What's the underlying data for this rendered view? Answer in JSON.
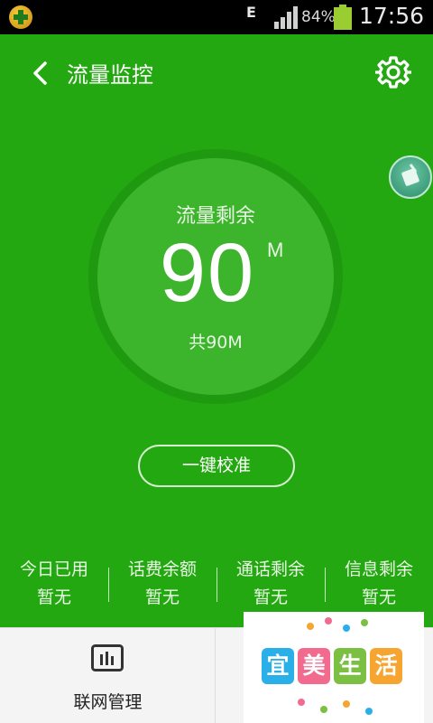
{
  "status_bar": {
    "network_type": "E",
    "battery_percent": "84%",
    "battery_level": 0.84,
    "time": "17:56",
    "app_icon": "plus-badge-icon",
    "signal_icon": "signal-bars-icon"
  },
  "header": {
    "title": "流量监控",
    "back_icon": "chevron-left-icon",
    "settings_icon": "gear-icon"
  },
  "gauge": {
    "label": "流量剩余",
    "value": "90",
    "unit": "M",
    "total": "共90M"
  },
  "calibrate_label": "一键校准",
  "stats": [
    {
      "label": "今日已用",
      "value": "暂无"
    },
    {
      "label": "话费余额",
      "value": "暂无"
    },
    {
      "label": "通话剩余",
      "value": "暂无"
    },
    {
      "label": "信息剩余",
      "value": "暂无"
    }
  ],
  "bottom_nav": {
    "network_label": "联网管理",
    "network_icon": "bar-chart-icon"
  },
  "promo": {
    "chars": [
      "宜",
      "美",
      "生",
      "活"
    ],
    "tile_colors": [
      "#2ab0e8",
      "#f26a8d",
      "#7bc043",
      "#f7a531"
    ]
  },
  "colors": {
    "primary": "#24a811",
    "gauge_ring": "#1f9a10",
    "gauge_fill": "#3cb42c"
  }
}
